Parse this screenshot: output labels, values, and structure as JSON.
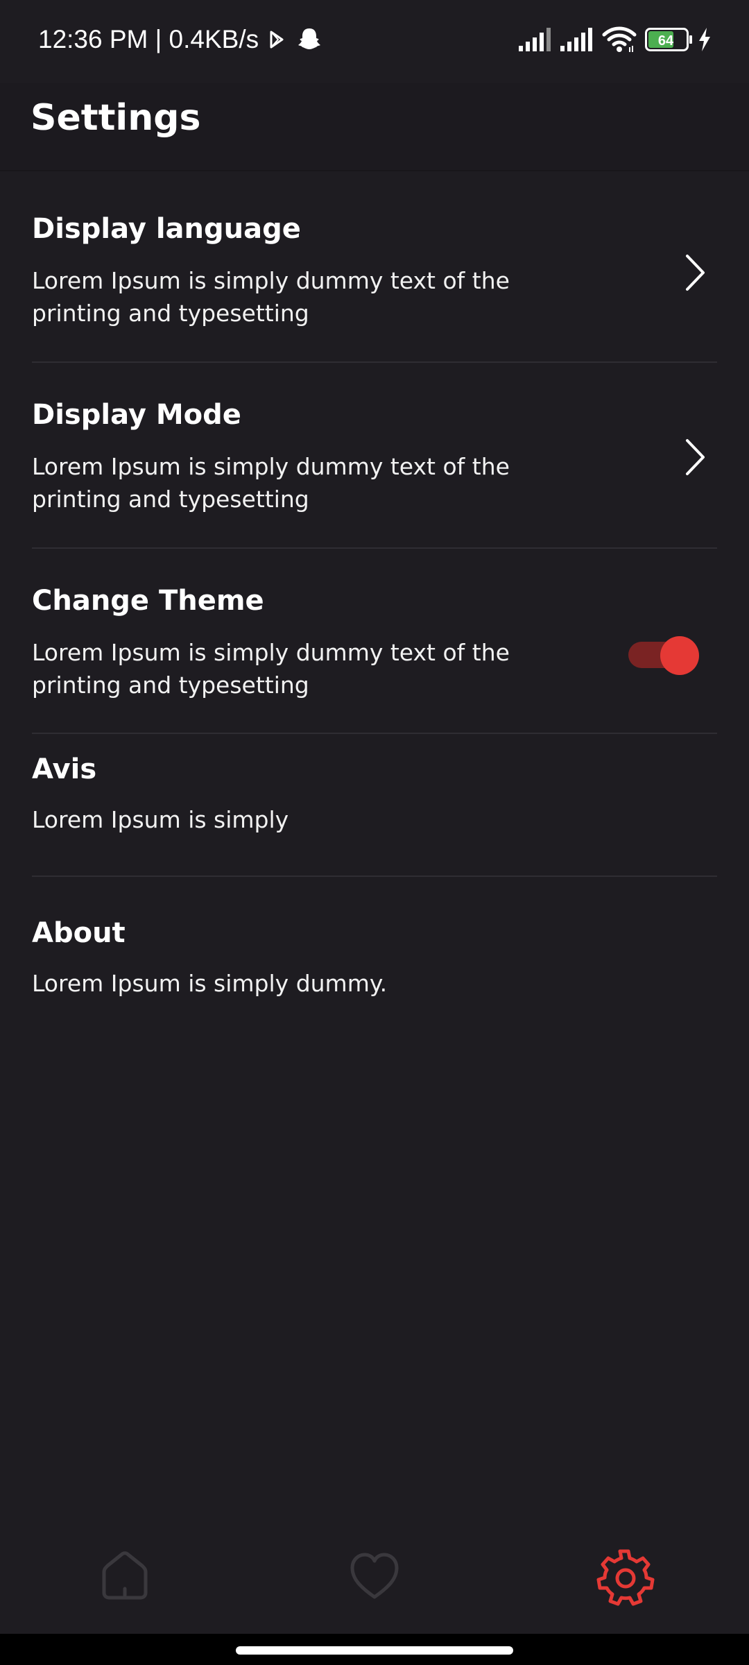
{
  "status_bar": {
    "time_speed": "12:36 PM | 0.4KB/s",
    "battery_level": "64",
    "icons": [
      "play-store-icon",
      "snapchat-icon",
      "signal-icon",
      "signal-icon",
      "wifi-icon",
      "battery-icon",
      "charging-icon"
    ]
  },
  "header": {
    "title": "Settings"
  },
  "settings": [
    {
      "title": "Display language",
      "description": "Lorem Ipsum is simply dummy text of the printing and typesetting",
      "action": "chevron-right-icon"
    },
    {
      "title": "Display Mode",
      "description": "Lorem Ipsum is simply dummy text of the printing and typesetting",
      "action": "chevron-right-icon"
    },
    {
      "title": "Change Theme",
      "description": "Lorem Ipsum is simply dummy text of the printing and typesetting",
      "action": "toggle",
      "toggle_on": true
    },
    {
      "title": "Avis",
      "description": "Lorem Ipsum is simply"
    },
    {
      "title": "About",
      "description": "Lorem Ipsum is simply dummy."
    }
  ],
  "bottom_nav": {
    "items": [
      {
        "icon": "home-icon",
        "active": false
      },
      {
        "icon": "heart-icon",
        "active": false
      },
      {
        "icon": "gear-icon",
        "active": true
      }
    ]
  },
  "colors": {
    "background": "#1e1c21",
    "accent": "#e53935",
    "inactive_icon": "#3a383d",
    "battery_fill": "#4caf50"
  }
}
